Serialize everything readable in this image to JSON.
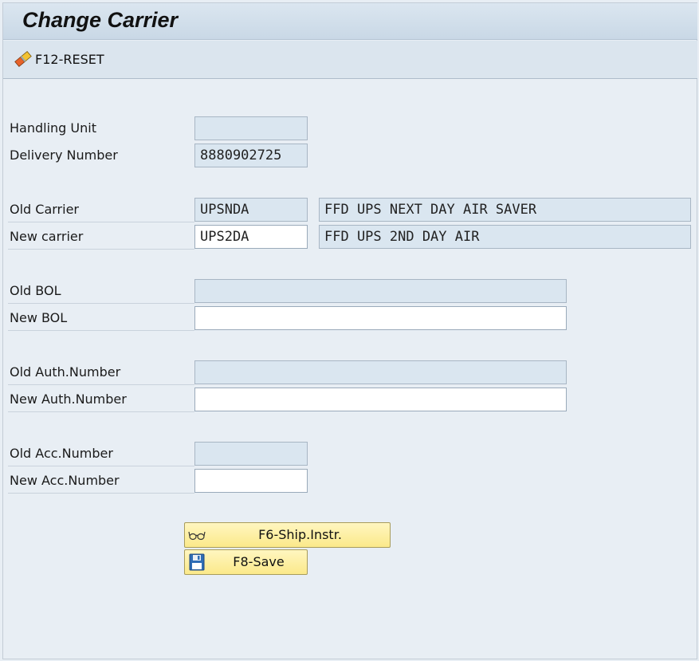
{
  "window": {
    "title": "Change Carrier"
  },
  "toolbar": {
    "reset_label": "F12-RESET",
    "reset_icon": "eraser-icon"
  },
  "form": {
    "handling_unit": {
      "label": "Handling Unit",
      "value": ""
    },
    "delivery_number": {
      "label": "Delivery Number",
      "value": "8880902725"
    },
    "old_carrier": {
      "label": "Old Carrier",
      "code": "UPSNDA",
      "description": "FFD UPS NEXT DAY AIR SAVER"
    },
    "new_carrier": {
      "label": "New carrier",
      "code": "UPS2DA",
      "description": "FFD UPS 2ND DAY AIR"
    },
    "old_bol": {
      "label": "Old BOL",
      "value": ""
    },
    "new_bol": {
      "label": "New BOL",
      "value": ""
    },
    "old_auth": {
      "label": "Old Auth.Number",
      "value": ""
    },
    "new_auth": {
      "label": "New Auth.Number",
      "value": ""
    },
    "old_acc": {
      "label": "Old Acc.Number",
      "value": ""
    },
    "new_acc": {
      "label": "New Acc.Number",
      "value": ""
    }
  },
  "buttons": {
    "ship_instr": {
      "label": "F6-Ship.Instr.",
      "icon": "glasses-icon"
    },
    "save": {
      "label": "F8-Save",
      "icon": "floppy-disk-icon"
    }
  },
  "colors": {
    "background": "#e8eef4",
    "readonly_field": "#dae6f0",
    "button_yellow": "#fbe98a"
  }
}
